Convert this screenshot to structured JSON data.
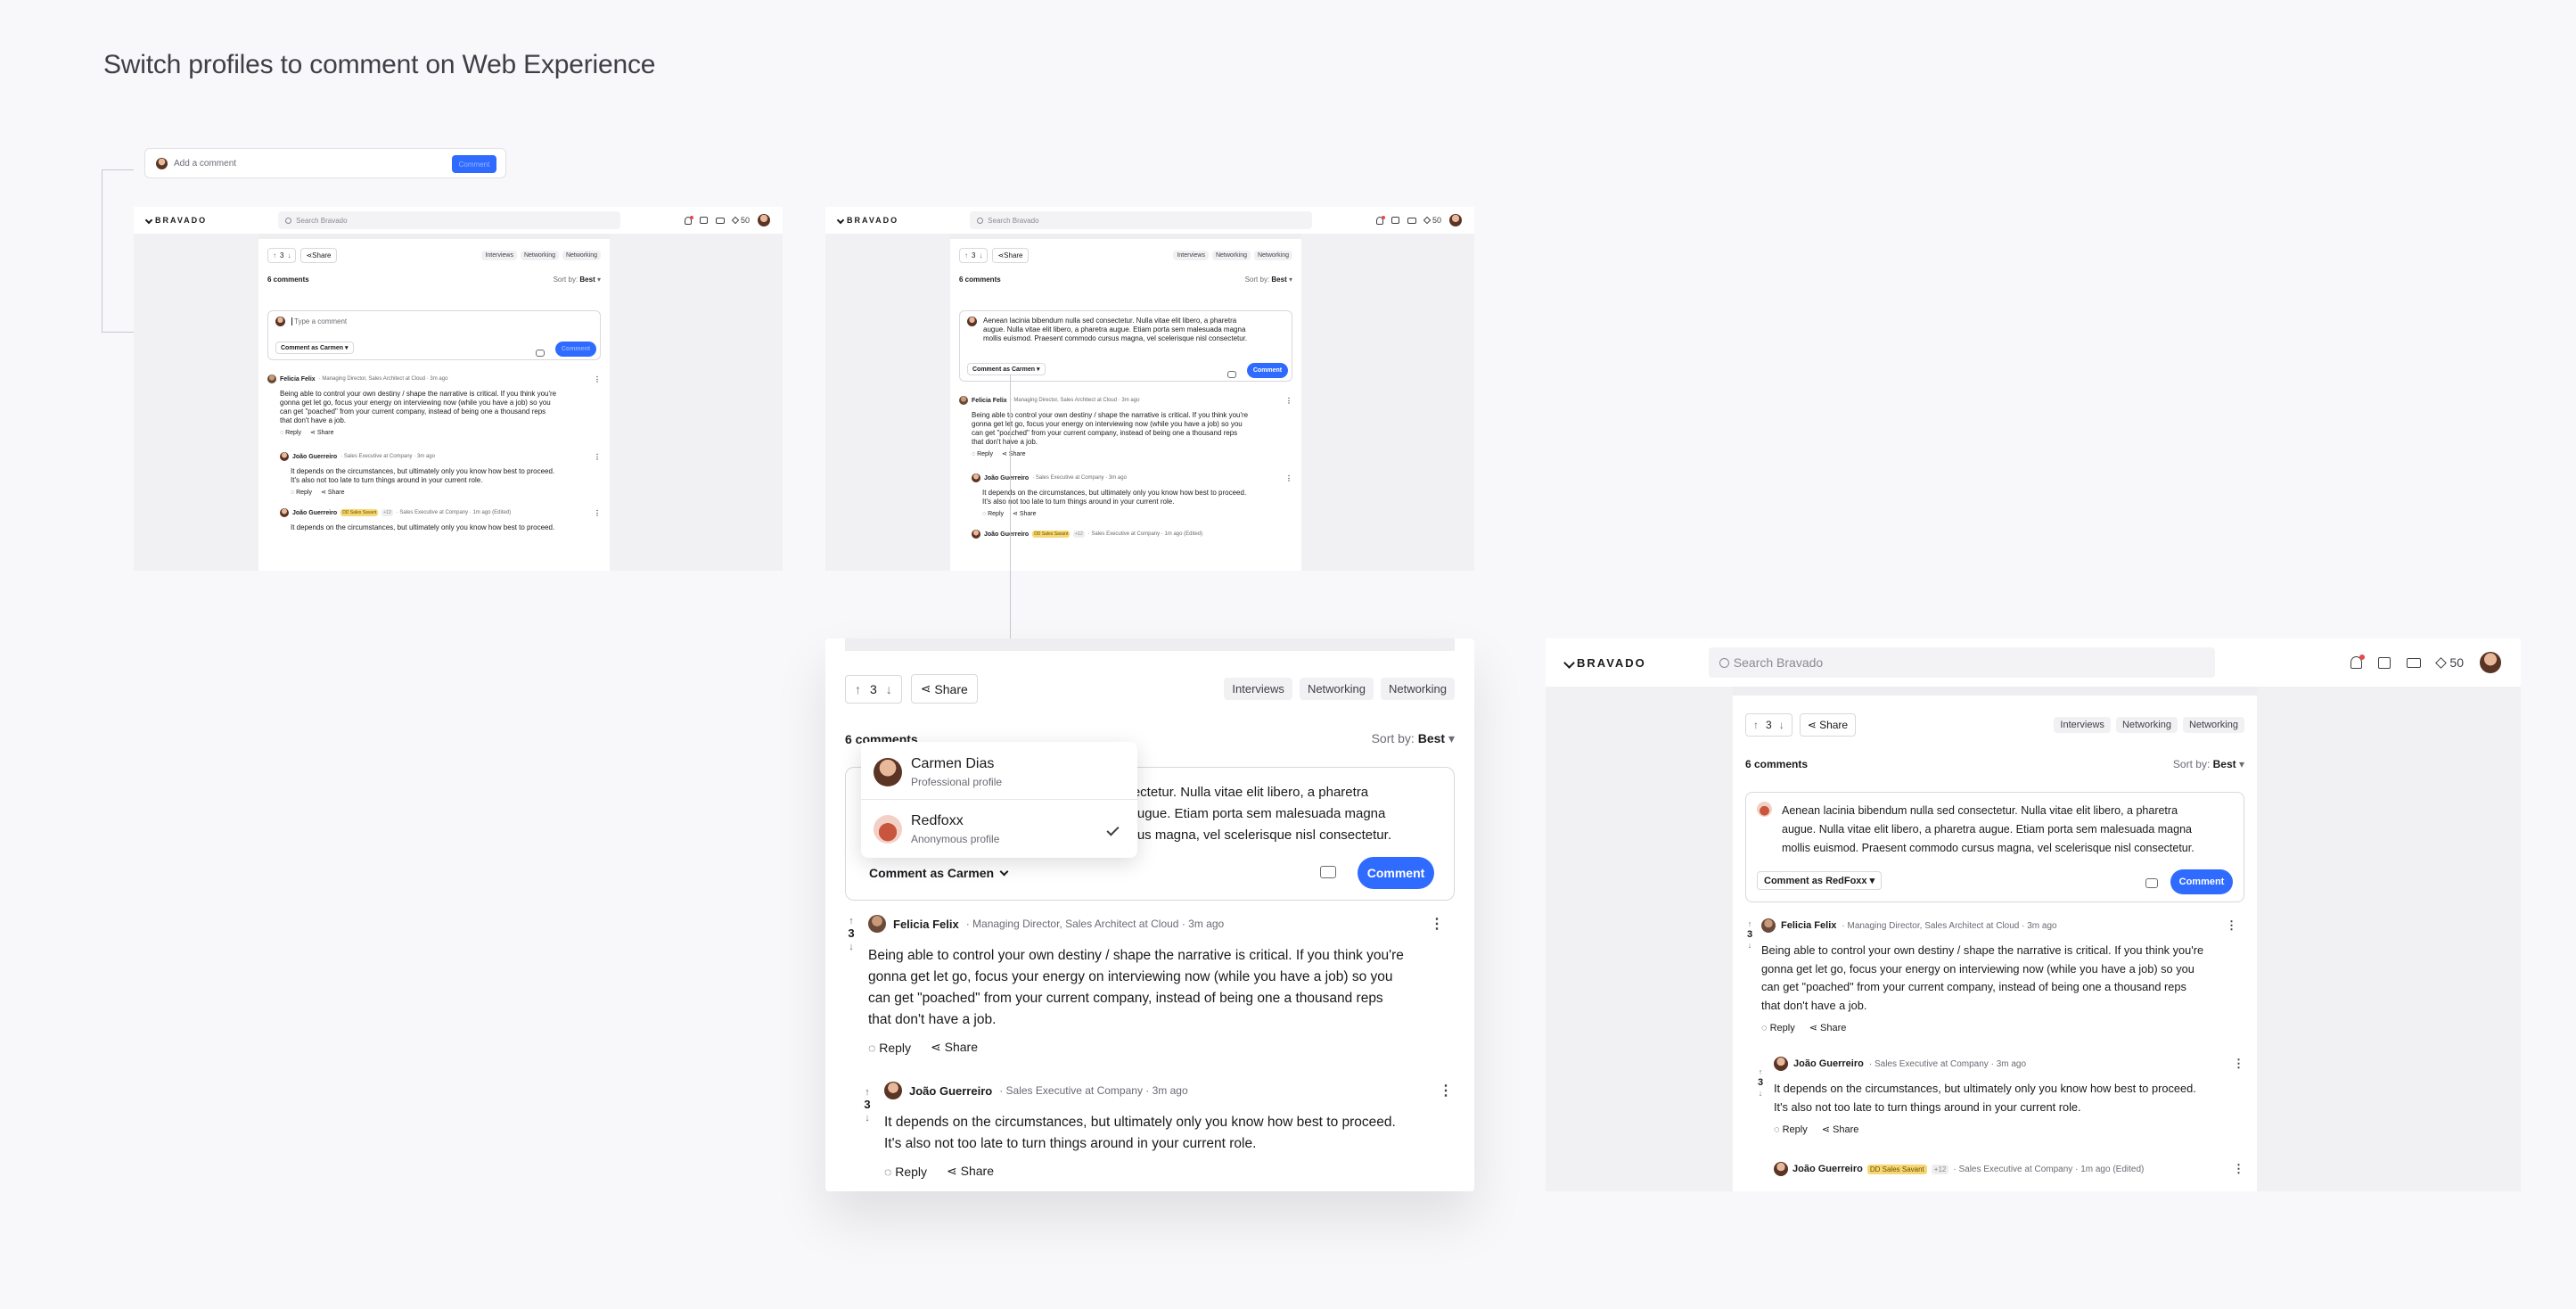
{
  "page": {
    "title": "Switch profiles to comment on Web Experience"
  },
  "mini_input": {
    "placeholder": "Add a comment",
    "button": "Comment"
  },
  "app": {
    "logo": "BRAVADO",
    "search_placeholder": "Search Bravado",
    "points": "50"
  },
  "post": {
    "votes": "3",
    "share": "Share",
    "tags": [
      "Interviews",
      "Networking",
      "Networking"
    ],
    "comment_count": "6 comments",
    "sort_label": "Sort by:",
    "sort_value": "Best"
  },
  "composer": {
    "placeholder": "Type a comment",
    "typed": "Aenean lacinia bibendum nulla sed consectetur. Nulla vitae elit libero, a pharetra augue. Nulla vitae elit libero, a pharetra augue. Etiam porta sem malesuada magna mollis euismod. Praesent commodo cursus magna, vel scelerisque nisl consectetur.",
    "typed_line1": "Aenean lacinia bibendum nulla sed consectetur. Nulla vitae elit libero, a pharetra",
    "typed_line2": "augue. Nulla vitae elit libero, a pharetra augue. Etiam porta sem malesuada magna",
    "typed_line3": "mollis euismod. Praesent commodo cursus magna, vel scelerisque nisl consectetur.",
    "zoom_line1": "nsectetur. Nulla vitae elit libero, a pharetra",
    "zoom_line2": "a augue. Etiam porta sem malesuada magna",
    "zoom_line3": "ursus magna, vel scelerisque nisl consectetur.",
    "comment_as_carmen": "Comment as Carmen",
    "comment_as_redfoxx": "Comment as RedFoxx",
    "button": "Comment"
  },
  "profiles": [
    {
      "name": "Carmen Dias",
      "type": "Professional profile"
    },
    {
      "name": "Redfoxx",
      "type": "Anonymous profile"
    }
  ],
  "comments": [
    {
      "author": "Felicia Felix",
      "meta": "· Managing Director, Sales Architect at Cloud · 3m ago",
      "votes": "3",
      "body": "Being able to control your own destiny / shape the narrative is critical. If you think you're gonna get let go, focus your energy on interviewing now (while you have a job) so you can get \"poached\" from your current company, instead of being one a thousand reps that don't have a job.",
      "line1": "Being able to control your own destiny / shape the narrative is critical. If you think you're",
      "line2": "gonna get let go, focus your energy on interviewing now (while you have a job) so you",
      "line3": "can get \"poached\" from your current company, instead of being one a thousand reps",
      "line4": "that don't have a job.",
      "reply": "Reply",
      "share": "Share"
    },
    {
      "author": "João Guerreiro",
      "meta": "· Sales Executive at Company · 3m ago",
      "votes": "3",
      "line1": "It depends on the circumstances, but ultimately only you know how best to proceed.",
      "line2": "It's also not too late to turn things around in your current role.",
      "reply": "Reply",
      "share": "Share"
    },
    {
      "author": "João Guerreiro",
      "badge": "DD Sales Savant",
      "extra": "+12",
      "meta": "· Sales Executive at Company · 1m ago (Edited)",
      "line1": "It depends on the circumstances, but ultimately only you know how best to proceed."
    }
  ]
}
